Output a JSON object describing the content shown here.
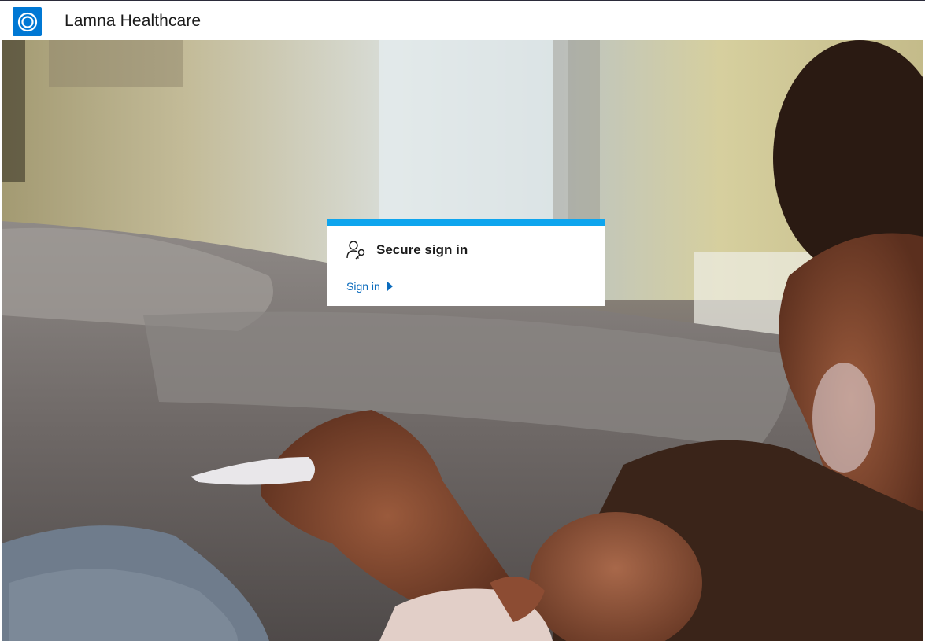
{
  "header": {
    "brand_name": "Lamna Healthcare",
    "logo_icon": "ring-logo-icon",
    "accent_color": "#0078d4"
  },
  "hero": {
    "image_name": "background-photo"
  },
  "signin_card": {
    "title": "Secure sign in",
    "title_icon": "user-key-icon",
    "link_label": "Sign in",
    "link_icon": "chevron-right-icon",
    "accent_color": "#0ea5ee",
    "link_color": "#0a6bbd"
  }
}
